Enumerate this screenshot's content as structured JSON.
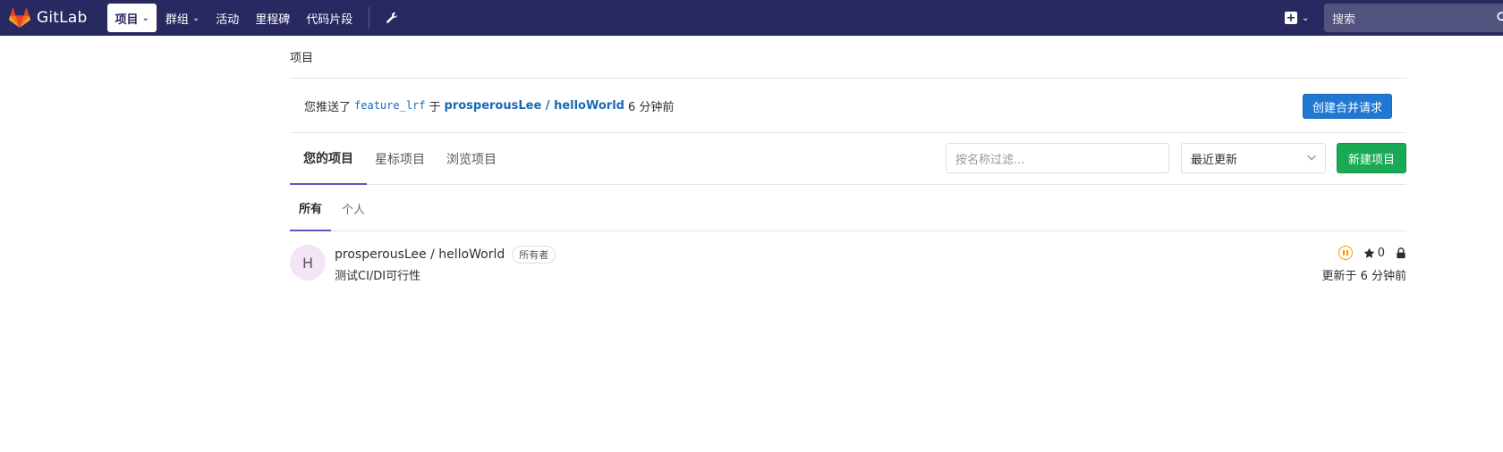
{
  "brand": {
    "name": "GitLab",
    "accent": "#292961"
  },
  "navbar": {
    "items": [
      {
        "label": "项目",
        "active": true,
        "dropdown": true
      },
      {
        "label": "群组",
        "active": false,
        "dropdown": true
      },
      {
        "label": "活动",
        "active": false,
        "dropdown": false
      },
      {
        "label": "里程碑",
        "active": false,
        "dropdown": false
      },
      {
        "label": "代码片段",
        "active": false,
        "dropdown": false
      }
    ],
    "admin_icon": "wrench-icon",
    "new_icon": "plus-square-icon",
    "search_placeholder": "搜索"
  },
  "breadcrumb": {
    "title": "项目"
  },
  "push_banner": {
    "prefix": "您推送了",
    "branch": "feature_lrf",
    "middle": "于",
    "project": "prosperousLee / helloWorld",
    "time": "6 分钟前",
    "button": "创建合并请求"
  },
  "tabs": {
    "items": [
      "您的项目",
      "星标项目",
      "浏览项目"
    ],
    "active": 0,
    "filter_placeholder": "按名称过滤...",
    "sort_value": "最近更新",
    "new_project_button": "新建项目"
  },
  "subtabs": {
    "items": [
      "所有",
      "个人"
    ],
    "active": 0
  },
  "projects": [
    {
      "avatar_letter": "H",
      "name": "prosperousLee / helloWorld",
      "role_badge": "所有者",
      "description": "测试CI/DI可行性",
      "pipeline_status": "paused",
      "stars": "0",
      "visibility": "private",
      "updated": "更新于 6 分钟前"
    }
  ]
}
